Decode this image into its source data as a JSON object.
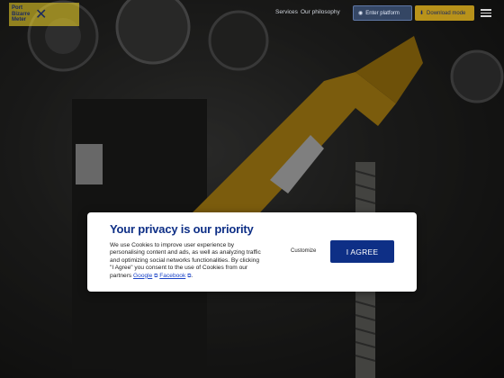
{
  "header": {
    "logo_text": "Port\nBizarre\nMeter",
    "nav": [
      "Services",
      "Our philosophy"
    ],
    "partner_label": "Enter platform",
    "download_label": "Download mode"
  },
  "consent": {
    "title": "Your privacy is our priority",
    "body_main": "We use Cookies to improve user experience by personalising content and ads, as well as analyzing traffic and optimizing social networks functionalities. By clicking \"I Agree\" you consent to the use of Cookies from our partners ",
    "link_google": "Google",
    "link_facebook": "Facebook",
    "end_punct": ".",
    "customize_label": "Customize",
    "agree_label": "I AGREE"
  },
  "colors": {
    "brand_blue": "#0e2f86",
    "brand_yellow": "#f0be1e"
  },
  "icons": {
    "wrench": "wrench-icon",
    "menu": "hamburger-menu-icon",
    "external": "external-link-icon"
  }
}
